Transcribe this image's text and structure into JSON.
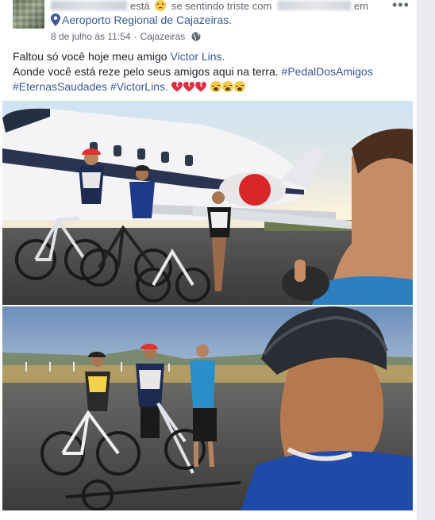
{
  "post": {
    "header": {
      "feeling_prefix": "está",
      "feeling_text": "se sentindo triste com",
      "at_word": "em",
      "location": "Aeroporto Regional de Cajazeiras.",
      "date": "8 de julho às 11:54",
      "separator": "·",
      "city": "Cajazeiras",
      "privacy_icon": "globe-icon",
      "more_label": "•••"
    },
    "text": {
      "line1_prefix": "Faltou só você hoje meu amigo",
      "mention": "Victor Lins.",
      "line2": "Aonde você está reze pelo seus amigos aqui na terra.",
      "hashtag1": "#PedalDosAmigos",
      "hashtag2": "#EternasSaudades",
      "hashtag3": "#VictorLins.",
      "emojis": [
        "broken-heart",
        "broken-heart",
        "broken-heart",
        "tired-face",
        "tired-face",
        "tired-face"
      ]
    },
    "photos": [
      {
        "description_name": "cyclists-at-airport-jet"
      },
      {
        "description_name": "cyclists-selfie-runway"
      }
    ]
  },
  "colors": {
    "link": "#385898",
    "text": "#1d2129",
    "meta": "#616770",
    "background": "#e9ebee"
  }
}
